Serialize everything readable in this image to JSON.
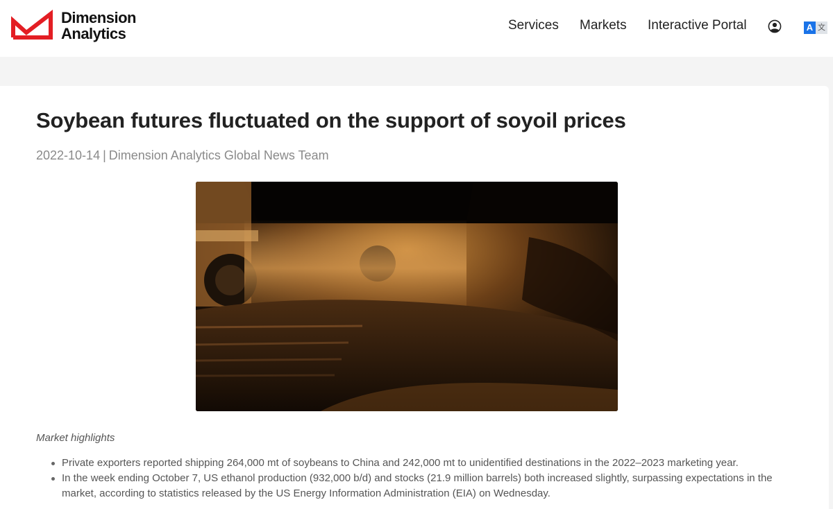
{
  "brand": {
    "name_line1": "Dimension",
    "name_line2": "Analytics",
    "accent_color": "#e31e24"
  },
  "nav": {
    "items": [
      {
        "label": "Services"
      },
      {
        "label": "Markets"
      },
      {
        "label": "Interactive Portal"
      }
    ],
    "user_icon": "user-circle-icon",
    "language_icon": "translate-icon",
    "language_glyph_a": "A",
    "language_glyph_b": "文"
  },
  "article": {
    "title": "Soybean futures fluctuated on the support of soyoil prices",
    "date": "2022-10-14",
    "separator": "|",
    "author": "Dimension Analytics Global News Team",
    "section_label": "Market highlights",
    "bullets": [
      "Private exporters reported shipping 264,000 mt of soybeans to China and 242,000 mt to unidentified destinations in the 2022–2023 marketing year.",
      "In the week ending October 7, US ethanol production (932,000 b/d) and stocks (21.9 million barrels) both increased slightly, surpassing expectations in the market, according to statistics released by the US Energy Information Administration (EIA) on Wednesday."
    ]
  }
}
